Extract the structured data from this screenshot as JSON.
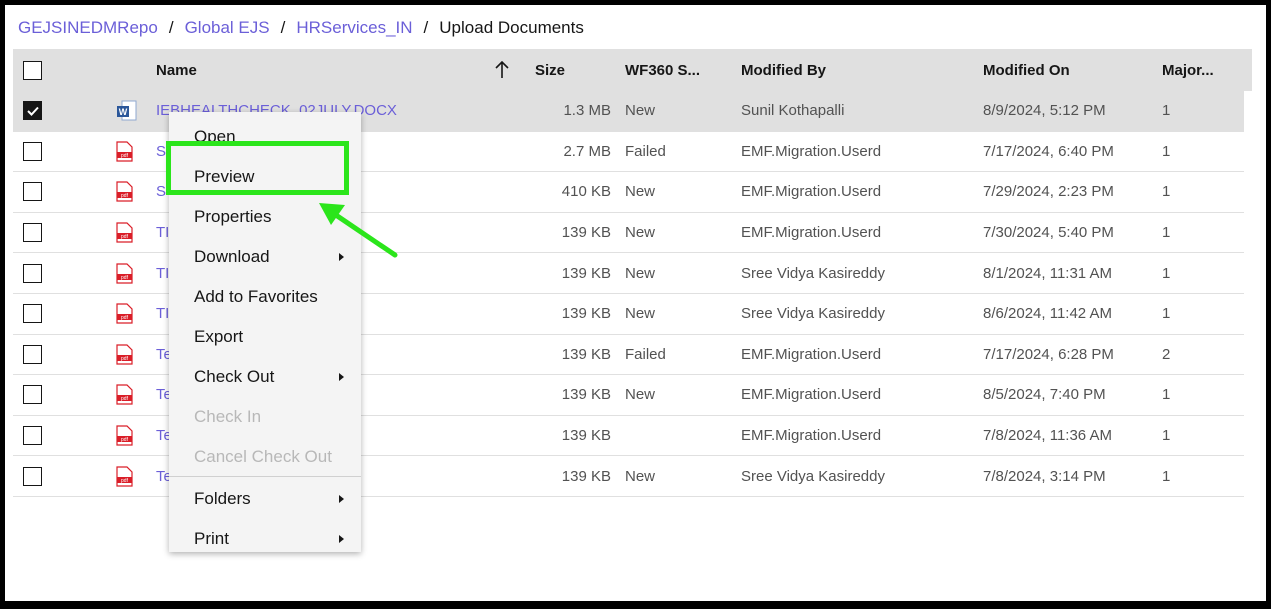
{
  "breadcrumb": {
    "items": [
      "GEJSINEDMRepo",
      "Global EJS",
      "HRServices_IN"
    ],
    "current": "Upload Documents",
    "separator": "/"
  },
  "table": {
    "columns": {
      "name": "Name",
      "size": "Size",
      "wf": "WF360 S...",
      "modified_by": "Modified By",
      "modified_on": "Modified On",
      "major": "Major..."
    },
    "sort_indicator": "up-arrow-icon",
    "rows": [
      {
        "icon": "word-doc-icon",
        "name": "IEBHEALTHCHECK_02JULY.DOCX",
        "size": "1.3 MB",
        "wf": "New",
        "modified_by": "Sunil Kothapalli",
        "modified_on": "8/9/2024, 5:12 PM",
        "major": "1",
        "checked": true
      },
      {
        "icon": "pdf-icon",
        "name": "S",
        "size": "2.7 MB",
        "wf": "Failed",
        "modified_by": "EMF.Migration.Userd",
        "modified_on": "7/17/2024, 6:40 PM",
        "major": "1",
        "checked": false
      },
      {
        "icon": "pdf-icon",
        "name": "S",
        "size": "410 KB",
        "wf": "New",
        "modified_by": "EMF.Migration.Userd",
        "modified_on": "7/29/2024, 2:23 PM",
        "major": "1",
        "checked": false
      },
      {
        "icon": "pdf-icon",
        "name": "TI",
        "size": "139 KB",
        "wf": "New",
        "modified_by": "EMF.Migration.Userd",
        "modified_on": "7/30/2024, 5:40 PM",
        "major": "1",
        "checked": false
      },
      {
        "icon": "pdf-icon",
        "name": "TI",
        "size": "139 KB",
        "wf": "New",
        "modified_by": "Sree Vidya Kasireddy",
        "modified_on": "8/1/2024, 11:31 AM",
        "major": "1",
        "checked": false
      },
      {
        "icon": "pdf-icon",
        "name": "TI",
        "size": "139 KB",
        "wf": "New",
        "modified_by": "Sree Vidya Kasireddy",
        "modified_on": "8/6/2024, 11:42 AM",
        "major": "1",
        "checked": false
      },
      {
        "icon": "pdf-icon",
        "name": "Te",
        "size": "139 KB",
        "wf": "Failed",
        "modified_by": "EMF.Migration.Userd",
        "modified_on": "7/17/2024, 6:28 PM",
        "major": "2",
        "checked": false
      },
      {
        "icon": "pdf-icon",
        "name": "Te",
        "size": "139 KB",
        "wf": "New",
        "modified_by": "EMF.Migration.Userd",
        "modified_on": "8/5/2024, 7:40 PM",
        "major": "1",
        "checked": false
      },
      {
        "icon": "pdf-icon",
        "name": "Te",
        "size": "139 KB",
        "wf": "",
        "modified_by": "EMF.Migration.Userd",
        "modified_on": "7/8/2024, 11:36 AM",
        "major": "1",
        "checked": false
      },
      {
        "icon": "pdf-icon",
        "name": "Te",
        "size": "139 KB",
        "wf": "New",
        "modified_by": "Sree Vidya Kasireddy",
        "modified_on": "7/8/2024, 3:14 PM",
        "major": "1",
        "checked": false
      }
    ]
  },
  "context_menu": {
    "items": [
      {
        "label": "Open",
        "disabled": false,
        "submenu": false
      },
      {
        "label": "Preview",
        "disabled": false,
        "submenu": false,
        "highlighted": true
      },
      {
        "label": "Properties",
        "disabled": false,
        "submenu": false
      },
      {
        "label": "Download",
        "disabled": false,
        "submenu": true
      },
      {
        "label": "Add to Favorites",
        "disabled": false,
        "submenu": false
      },
      {
        "label": "Export",
        "disabled": false,
        "submenu": false
      },
      {
        "label": "Check Out",
        "disabled": false,
        "submenu": true
      },
      {
        "label": "Check In",
        "disabled": true,
        "submenu": false
      },
      {
        "label": "Cancel Check Out",
        "disabled": true,
        "submenu": false
      },
      {
        "label": "Folders",
        "disabled": false,
        "submenu": true
      },
      {
        "label": "Print",
        "disabled": false,
        "submenu": true
      }
    ]
  },
  "colors": {
    "link": "#6b5fd8",
    "highlight": "#2be51b",
    "header_bg": "#e0e0e0",
    "pdf_red": "#da1e28",
    "word_blue": "#2b579a"
  }
}
